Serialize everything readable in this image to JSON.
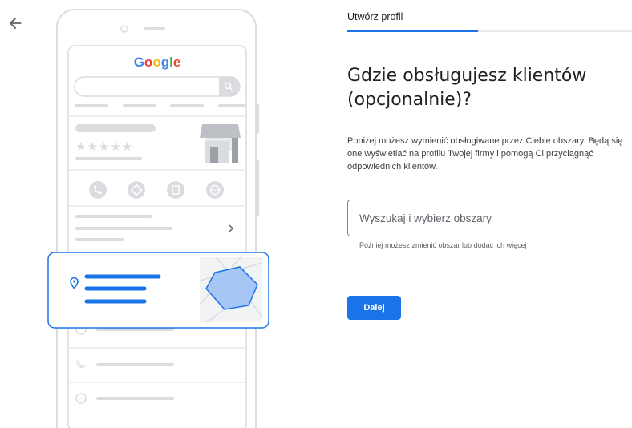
{
  "nav": {
    "back_icon": "arrow-left-icon"
  },
  "header": {
    "title": "Utwórz profil",
    "progress": 0.46
  },
  "illustration": {
    "google_logo": "Google",
    "brand_colors": {
      "blue": "#4285F4",
      "red": "#EA4335",
      "yellow": "#FBBC05",
      "green": "#34A853"
    },
    "stars": "★★★★★",
    "action_icons": [
      "phone-icon",
      "directions-icon",
      "bookmark-icon",
      "globe-icon"
    ],
    "chevron": "›",
    "card_icon": "location-pin-icon",
    "list_icons": [
      "clock-icon",
      "phone-icon",
      "globe-icon"
    ]
  },
  "main": {
    "heading": "Gdzie obsługujesz klientów (opcjonalnie)?",
    "description": "Poniżej możesz wymienić obsługiwane przez Ciebie obszary. Będą się one wyświetlać na profilu Twojej firmy i pomogą Ci przyciągnąć odpowiednich klientów.",
    "search_placeholder": "Wyszukaj i wybierz obszary",
    "search_value": "",
    "hint": "Później możesz zmienić obszar lub dodać ich więcej",
    "next_label": "Dalej"
  },
  "colors": {
    "accent": "#1a73e8",
    "track": "#e8eaed"
  }
}
